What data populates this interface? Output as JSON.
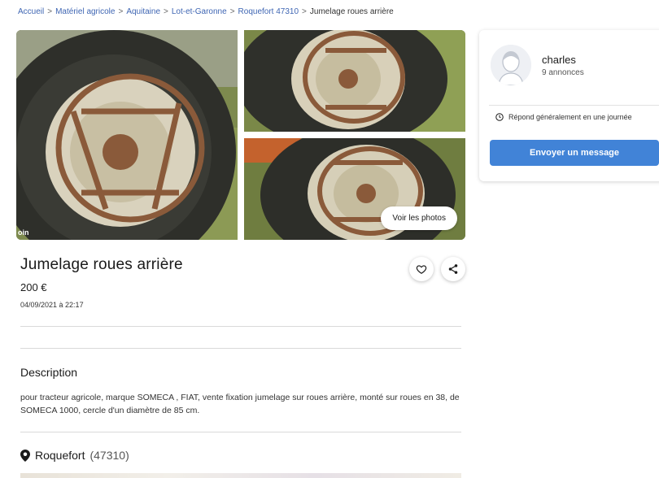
{
  "breadcrumb": {
    "items": [
      "Accueil",
      "Matériel agricole",
      "Aquitaine",
      "Lot-et-Garonne",
      "Roquefort 47310"
    ],
    "separator": ">",
    "current": "Jumelage roues arrière"
  },
  "gallery": {
    "photo_tag": "oin",
    "see_photos_label": "Voir les photos"
  },
  "listing": {
    "title": "Jumelage roues arrière",
    "price": "200 €",
    "date": "04/09/2021 à 22:17",
    "description_heading": "Description",
    "description": "pour tracteur agricole, marque SOMECA , FIAT, vente fixation jumelage sur roues arrière, monté sur roues en 38, de SOMECA 1000, cercle d'un diamètre de 85 cm.",
    "location_city": "Roquefort",
    "location_zip": "(47310)"
  },
  "seller": {
    "name": "charles",
    "ads_count": "9 annonces",
    "response_time": "Répond généralement en une journée",
    "message_button": "Envoyer un message"
  },
  "colors": {
    "link": "#3f66b3",
    "button": "#4183d7",
    "grass": "#6b7a3c",
    "rust": "#8a5a3a"
  }
}
